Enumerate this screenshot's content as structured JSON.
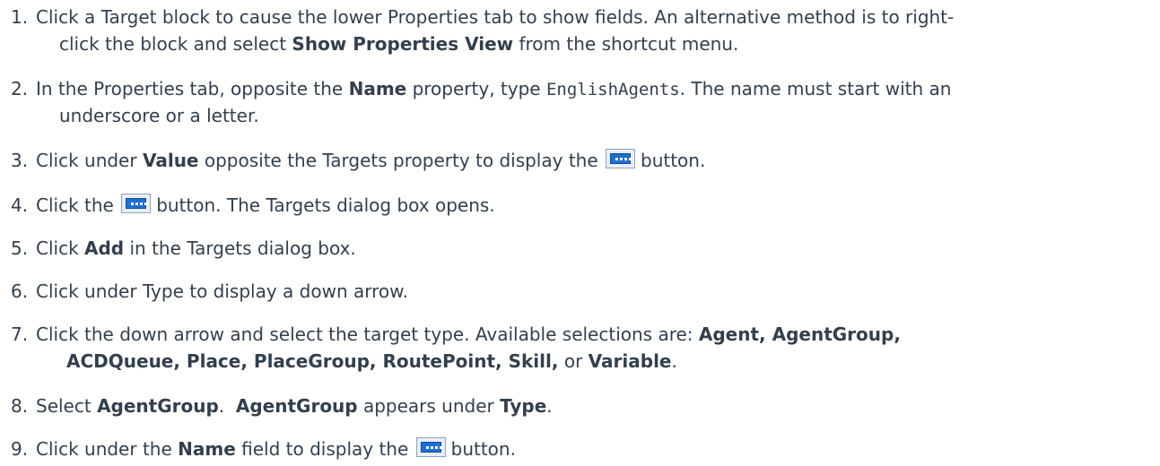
{
  "steps": [
    {
      "number": "1.",
      "line1": {
        "t1": "Click a Target block to cause the lower Properties tab to show fields. An alternative method is to right-"
      },
      "line2": {
        "t1": "click the block and select ",
        "b1": "Show Properties View",
        "t2": " from the shortcut menu."
      }
    },
    {
      "number": "2.",
      "line1": {
        "t1": "In the Properties tab, opposite the ",
        "b1": "Name",
        "t2": " property, type ",
        "code": "EnglishAgents",
        "t3": ". The name must start with an"
      },
      "line2": {
        "t1": "underscore or a letter."
      }
    },
    {
      "number": "3.",
      "t1": "Click under ",
      "b1": "Value",
      "t2": " opposite the Targets property to display the",
      "icon": "ellipsis-button-icon",
      "t3": "button."
    },
    {
      "number": "4.",
      "t1": "Click the",
      "icon": "ellipsis-button-icon",
      "t2": "button. The Targets dialog box opens."
    },
    {
      "number": "5.",
      "t1": "Click ",
      "b1": "Add",
      "t2": " in the Targets dialog box."
    },
    {
      "number": "6.",
      "t1": "Click under Type to display a down arrow."
    },
    {
      "number": "7.",
      "line1": {
        "t1": "Click the down arrow and select the target type. Available selections are: ",
        "b1": "Agent, AgentGroup,"
      },
      "line2": {
        "b1": "ACDQueue, Place, PlaceGroup, RoutePoint, Skill,",
        "t1": " or ",
        "b2": "Variable",
        "t2": "."
      }
    },
    {
      "number": "8.",
      "t1": "Select ",
      "b1": "AgentGroup",
      "t2": ".  ",
      "b2": "AgentGroup",
      "t3": " appears under ",
      "b3": "Type",
      "t4": "."
    },
    {
      "number": "9.",
      "t1": "Click under the ",
      "b1": "Name",
      "t2": " field to display the",
      "icon": "ellipsis-button-icon",
      "t3": "button."
    }
  ]
}
